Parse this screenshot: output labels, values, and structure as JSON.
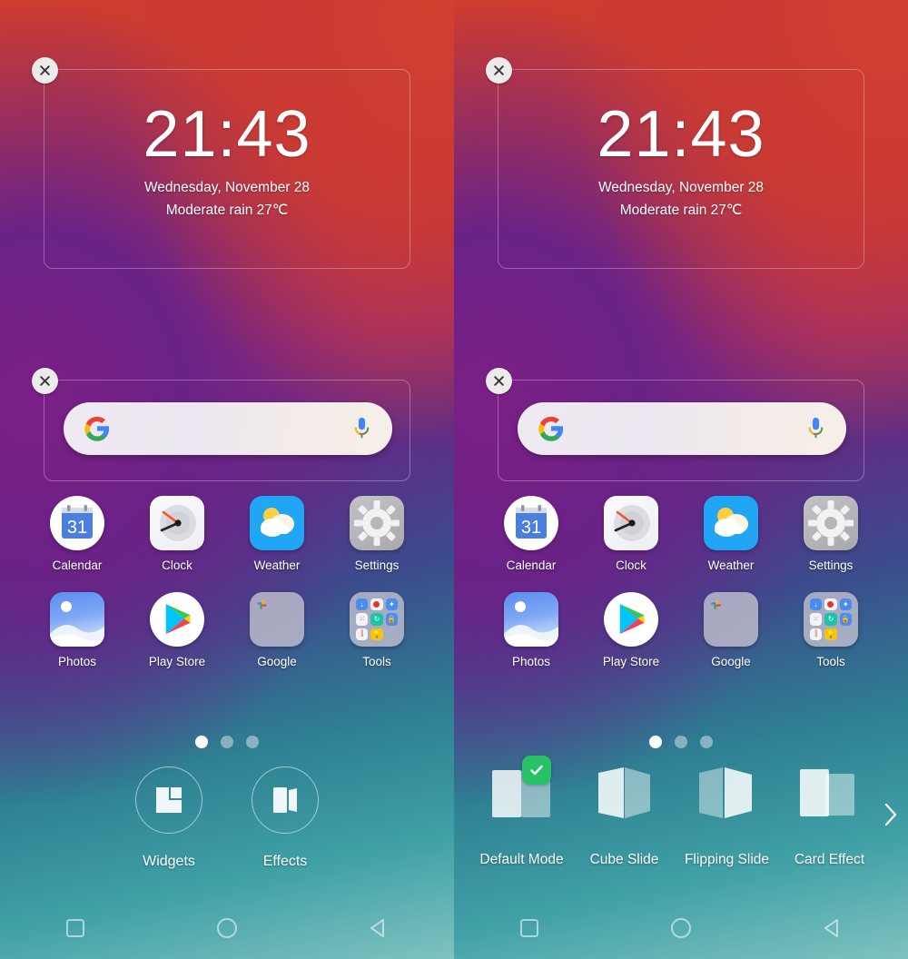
{
  "screens": [
    {
      "id": "left",
      "mode": "edit-home-screen",
      "bottom_panel": "tools"
    },
    {
      "id": "right",
      "mode": "transition-effects-picker",
      "bottom_panel": "effects"
    }
  ],
  "clock_widget": {
    "time": "21:43",
    "date": "Wednesday, November 28",
    "weather": "Moderate rain 27℃",
    "close_icon": "close-icon"
  },
  "search_widget": {
    "logo_icon": "google-g-icon",
    "mic_icon": "microphone-icon",
    "placeholder": "",
    "close_icon": "close-icon"
  },
  "apps": [
    [
      {
        "label": "Calendar",
        "icon": "calendar-icon",
        "badge": "31"
      },
      {
        "label": "Clock",
        "icon": "clock-icon"
      },
      {
        "label": "Weather",
        "icon": "weather-icon"
      },
      {
        "label": "Settings",
        "icon": "settings-gear-icon"
      }
    ],
    [
      {
        "label": "Photos",
        "icon": "photos-icon"
      },
      {
        "label": "Play Store",
        "icon": "play-store-icon"
      },
      {
        "label": "Google",
        "icon": "google-folder-icon"
      },
      {
        "label": "Tools",
        "icon": "tools-folder-icon"
      }
    ]
  ],
  "page_dots": {
    "count": 3,
    "active_index": 0
  },
  "home_tools": [
    {
      "label": "Widgets",
      "icon": "widgets-icon"
    },
    {
      "label": "Effects",
      "icon": "effects-icon"
    }
  ],
  "effects": {
    "items": [
      {
        "label": "Default Mode",
        "icon": "default-mode-icon",
        "selected": true
      },
      {
        "label": "Cube Slide",
        "icon": "cube-slide-icon",
        "selected": false
      },
      {
        "label": "Flipping Slide",
        "icon": "flipping-slide-icon",
        "selected": false
      },
      {
        "label": "Card Effect",
        "icon": "card-effect-icon",
        "selected": false
      }
    ],
    "next_icon": "chevron-right-icon",
    "check_icon": "check-icon"
  },
  "navbar": [
    {
      "name": "recents",
      "icon": "square-icon"
    },
    {
      "name": "home",
      "icon": "circle-icon"
    },
    {
      "name": "back",
      "icon": "triangle-left-icon"
    }
  ],
  "colors": {
    "accent_green": "#27c267",
    "bg_red": "#cf3c2e",
    "bg_purple": "#5d2e86",
    "bg_teal": "#3fa0a6",
    "pill": "#efeaf2"
  }
}
